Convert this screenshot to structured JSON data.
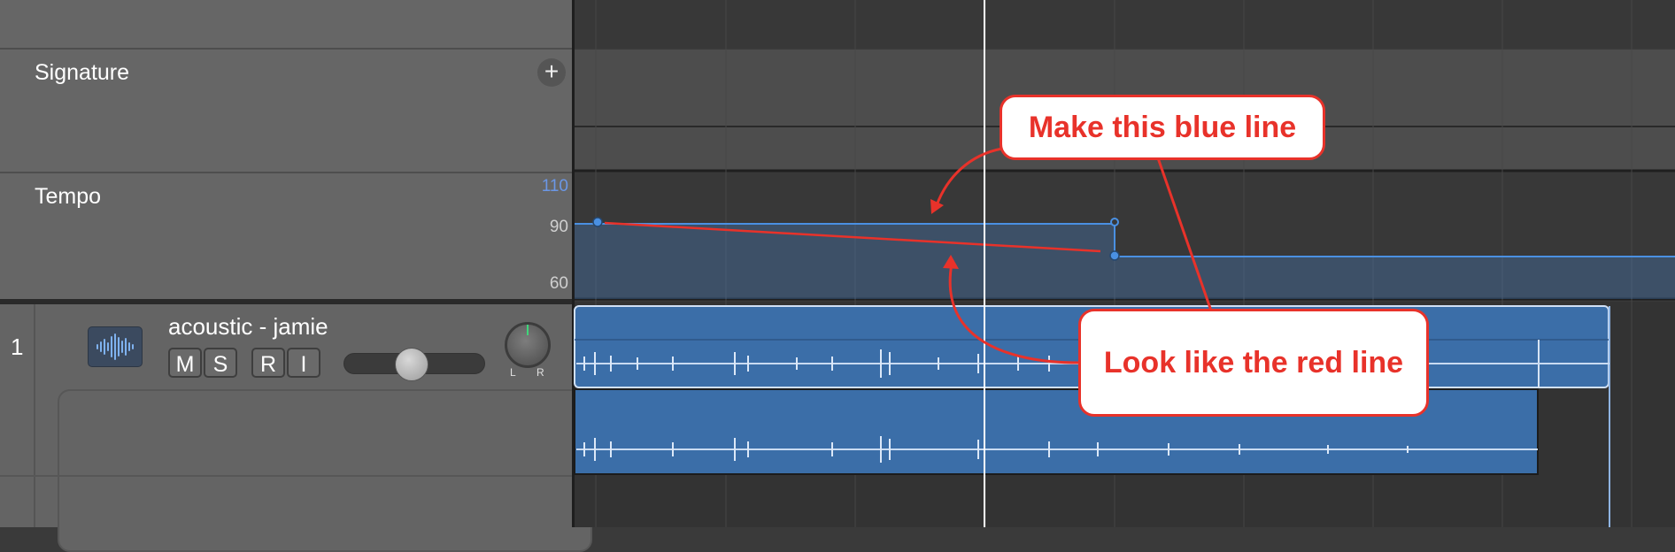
{
  "global_tracks": {
    "signature": {
      "label": "Signature",
      "add_symbol": "+"
    },
    "tempo": {
      "label": "Tempo",
      "ticks": {
        "top": "110",
        "mid": "90",
        "bottom": "60"
      }
    }
  },
  "track": {
    "number": "1",
    "icon": "waveform-icon",
    "name": "acoustic - jamie",
    "buttons": {
      "mute": "M",
      "solo": "S",
      "record": "R",
      "input": "I"
    },
    "pan_left": "L",
    "pan_right": "R"
  },
  "annotations": {
    "top": "Make this blue line",
    "bottom": "Look like the red line"
  },
  "colors": {
    "accent_blue": "#4a90e2",
    "region_blue": "#3b6ea8",
    "annotation_red": "#e8322a",
    "tempo_top_tick": "#6b97e6"
  }
}
